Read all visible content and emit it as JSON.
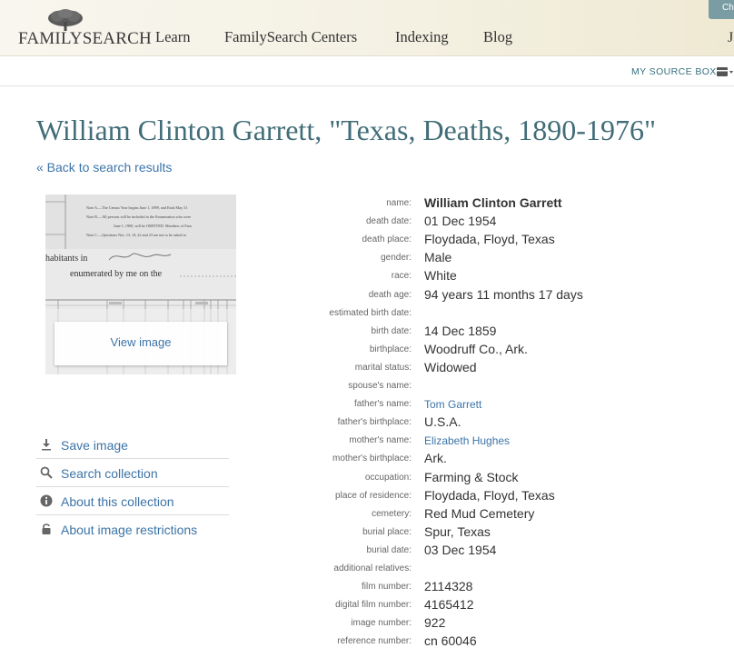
{
  "header": {
    "logo_text": "FAMILYSEARCH",
    "nav": [
      "Learn",
      "FamilySearch Centers",
      "Indexing",
      "Blog"
    ],
    "corner_button": "Ch",
    "corner_text": "J"
  },
  "source_bar": {
    "label": "MY SOURCE BOX"
  },
  "page": {
    "title": "William Clinton Garrett, \"Texas, Deaths, 1890-1976\"",
    "back_link": "« Back to search results"
  },
  "image": {
    "view_label": "View image",
    "doc_lines": [
      "Note A.—The Census Year begins June 1, 1899, and Ends May 31",
      "Note B.—All persons will be included in the Enumeration who were",
      "June 1, 1900, will be OMITTED. Members of Fam",
      "Note C.—Questions Nos. 13, 14, 22 and 23 are not to be asked in"
    ],
    "doc_text_1": "habitants in",
    "doc_text_2": "enumerated by me on the"
  },
  "actions": [
    {
      "label": "Save image",
      "icon": "download-icon"
    },
    {
      "label": "Search collection",
      "icon": "search-icon"
    },
    {
      "label": "About this collection",
      "icon": "info-icon"
    },
    {
      "label": "About image restrictions",
      "icon": "lock-icon"
    }
  ],
  "record": [
    {
      "key": "name:",
      "value": "William Clinton Garrett",
      "style": "bold"
    },
    {
      "key": "death date:",
      "value": "01 Dec 1954"
    },
    {
      "key": "death place:",
      "value": "Floydada, Floyd, Texas"
    },
    {
      "key": "gender:",
      "value": "Male"
    },
    {
      "key": "race:",
      "value": "White"
    },
    {
      "key": "death age:",
      "value": "94 years 11 months 17 days"
    },
    {
      "key": "estimated birth date:",
      "value": ""
    },
    {
      "key": "birth date:",
      "value": "14 Dec 1859"
    },
    {
      "key": "birthplace:",
      "value": "Woodruff Co., Ark."
    },
    {
      "key": "marital status:",
      "value": "Widowed"
    },
    {
      "key": "spouse's name:",
      "value": ""
    },
    {
      "key": "father's name:",
      "value": "Tom Garrett",
      "style": "link"
    },
    {
      "key": "father's birthplace:",
      "value": "U.S.A."
    },
    {
      "key": "mother's name:",
      "value": "Elizabeth Hughes",
      "style": "link"
    },
    {
      "key": "mother's birthplace:",
      "value": "Ark."
    },
    {
      "key": "occupation:",
      "value": "Farming & Stock"
    },
    {
      "key": "place of residence:",
      "value": "Floydada, Floyd, Texas"
    },
    {
      "key": "cemetery:",
      "value": "Red Mud Cemetery"
    },
    {
      "key": "burial place:",
      "value": "Spur, Texas"
    },
    {
      "key": "burial date:",
      "value": "03 Dec 1954"
    },
    {
      "key": "additional relatives:",
      "value": ""
    },
    {
      "key": "film number:",
      "value": "2114328"
    },
    {
      "key": "digital film number:",
      "value": "4165412"
    },
    {
      "key": "image number:",
      "value": "922"
    },
    {
      "key": "reference number:",
      "value": "cn 60046"
    }
  ]
}
